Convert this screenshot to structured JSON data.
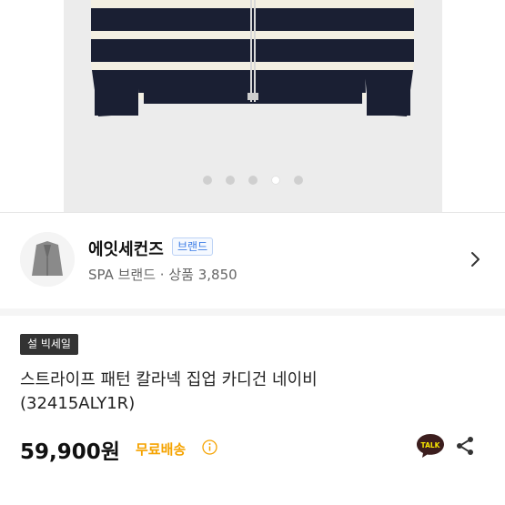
{
  "product_gallery": {
    "slide_count": 5,
    "active_slide": 4
  },
  "brand": {
    "name": "에잇세컨즈",
    "badge": "브랜드",
    "meta": "SPA 브랜드 · 상품 3,850"
  },
  "product": {
    "sale_tag": "설 빅세일",
    "title": "스트라이프 패턴 칼라넥 집업 카디건  네이비 (32415ALY1R)",
    "price": "59,900원",
    "shipping": "무료배송",
    "talk_label": "TALK"
  },
  "colors": {
    "shipping": "#f5a300",
    "badge": "#3d7de6",
    "tag_bg": "#333333"
  }
}
